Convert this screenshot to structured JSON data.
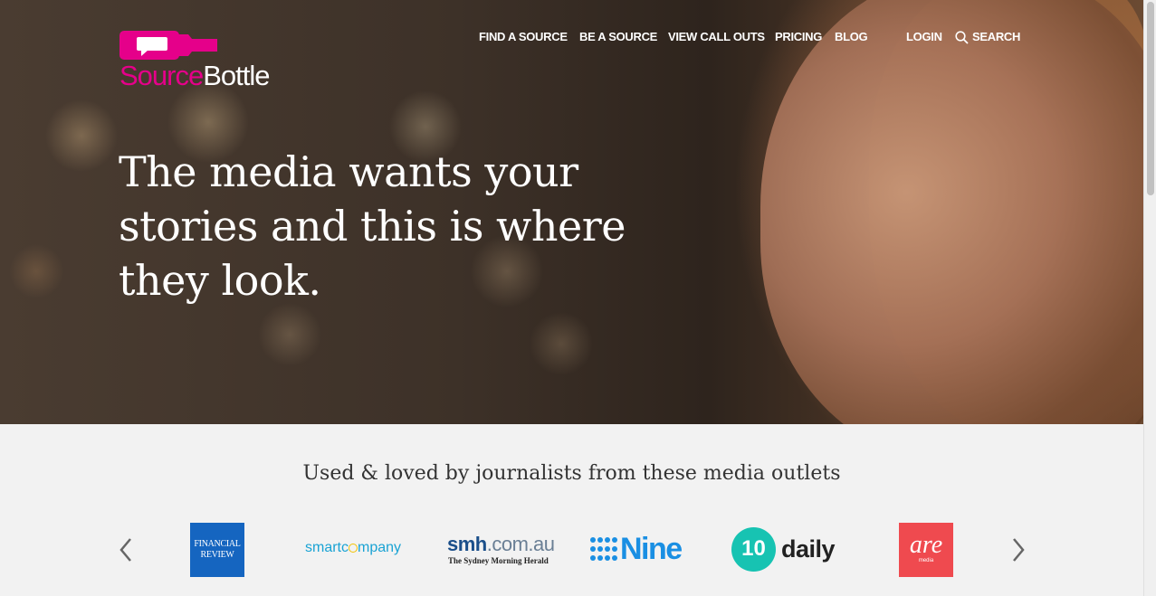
{
  "brand": {
    "source": "Source",
    "bottle": "Bottle",
    "brand_color": "#e5008a"
  },
  "nav": {
    "find_a_source": "FIND A SOURCE",
    "be_a_source": "BE A SOURCE",
    "view_call_outs": "VIEW CALL OUTS",
    "pricing": "PRICING",
    "blog": "BLOG",
    "login": "LOGIN",
    "search": "SEARCH"
  },
  "hero": {
    "headline_line1": "The media wants your",
    "headline_line2": "stories and this is where",
    "headline_line3": "they look."
  },
  "outlets": {
    "title": "Used & loved by journalists from these media outlets",
    "logos": {
      "afr_line1": "FINANCIAL",
      "afr_line2": "REVIEW",
      "smartcompany_a": "smartc",
      "smartcompany_b": "mpany",
      "smh_main": "smh",
      "smh_domain": ".com.au",
      "smh_sub": "The Sydney Morning Herald",
      "nine": "Nine",
      "ten_number": "10",
      "ten_word": "daily",
      "are_main": "are",
      "are_sub": "media"
    },
    "colors": {
      "afr": "#1565c0",
      "smartcompany": "#1aa3d4",
      "smh": "#1b4f8a",
      "nine": "#1a8fe3",
      "ten": "#17c3b2",
      "are": "#ef4a4f"
    }
  },
  "icons": {
    "prev": "chevron-left-icon",
    "next": "chevron-right-icon",
    "search": "magnifier-icon"
  }
}
